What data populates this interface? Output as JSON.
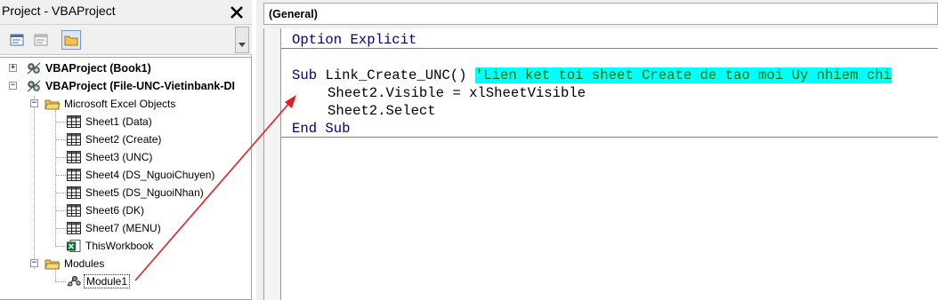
{
  "project_pane": {
    "title": "Project - VBAProject",
    "close_glyph": "✕",
    "toolbar": [
      {
        "name": "view-code-icon",
        "active": false
      },
      {
        "name": "view-object-icon",
        "active": false
      },
      {
        "name": "toggle-folders-icon",
        "active": true
      }
    ],
    "tree": {
      "book1": "VBAProject (Book1)",
      "file_project": "VBAProject (File-UNC-Vietinbank-DI",
      "excel_objects": "Microsoft Excel Objects",
      "sheets": [
        "Sheet1 (Data)",
        "Sheet2 (Create)",
        "Sheet3 (UNC)",
        "Sheet4 (DS_NguoiChuyen)",
        "Sheet5 (DS_NguoiNhan)",
        "Sheet6 (DK)",
        "Sheet7 (MENU)"
      ],
      "workbook": "ThisWorkbook",
      "modules_folder": "Modules",
      "module1": "Module1"
    }
  },
  "code_window": {
    "procedure_combo": "(General)",
    "lines": {
      "option": "Option",
      "explicit": "Explicit",
      "sub_kw": "Sub",
      "sub_name": "Link_Create_UNC()",
      "comment": "'Lien ket toi sheet Create de tao moi Uy nhiem chi",
      "line_visible": "Sheet2.Visible = xlSheetVisible",
      "line_select": "Sheet2.Select",
      "end_kw": "End Sub"
    }
  },
  "colors": {
    "keyword": "#00007f",
    "comment": "#007000",
    "highlight": "#00ffff",
    "annotation_arrow": "#e02020"
  }
}
